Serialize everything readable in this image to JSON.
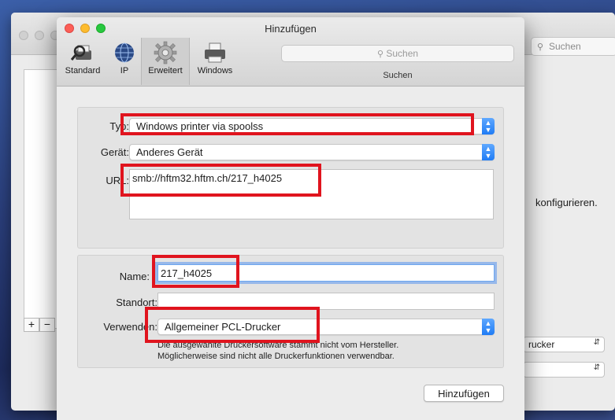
{
  "background_window": {
    "search_placeholder": "Suchen",
    "side_text": "konfigurieren.",
    "add_label": "+",
    "remove_label": "−",
    "select_1": "rucker",
    "select_2": ""
  },
  "dialog": {
    "title": "Hinzufügen",
    "toolbar": {
      "items": [
        {
          "label": "Standard",
          "icon": "printer-search-icon"
        },
        {
          "label": "IP",
          "icon": "globe-icon"
        },
        {
          "label": "Erweitert",
          "icon": "gear-icon",
          "active": true
        },
        {
          "label": "Windows",
          "icon": "printer-icon"
        }
      ],
      "search_placeholder": "Suchen",
      "search_label": "Suchen"
    },
    "connection": {
      "type_label": "Typ:",
      "type_value": "Windows printer via spoolss",
      "device_label": "Gerät:",
      "device_value": "Anderes Gerät",
      "url_label": "URL:",
      "url_value": "smb://hftm32.hftm.ch/217_h4025"
    },
    "printer": {
      "name_label": "Name:",
      "name_value": "217_h4025",
      "location_label": "Standort:",
      "location_value": "",
      "use_label": "Verwenden:",
      "use_value": "Allgemeiner PCL-Drucker",
      "note_line1": "Die ausgewählte Druckersoftware stammt nicht vom Hersteller.",
      "note_line2": "Möglicherweise sind nicht alle Druckerfunktionen verwendbar."
    },
    "add_button": "Hinzufügen"
  },
  "colors": {
    "highlight": "#e0141e",
    "accent": "#1f7cf5"
  }
}
